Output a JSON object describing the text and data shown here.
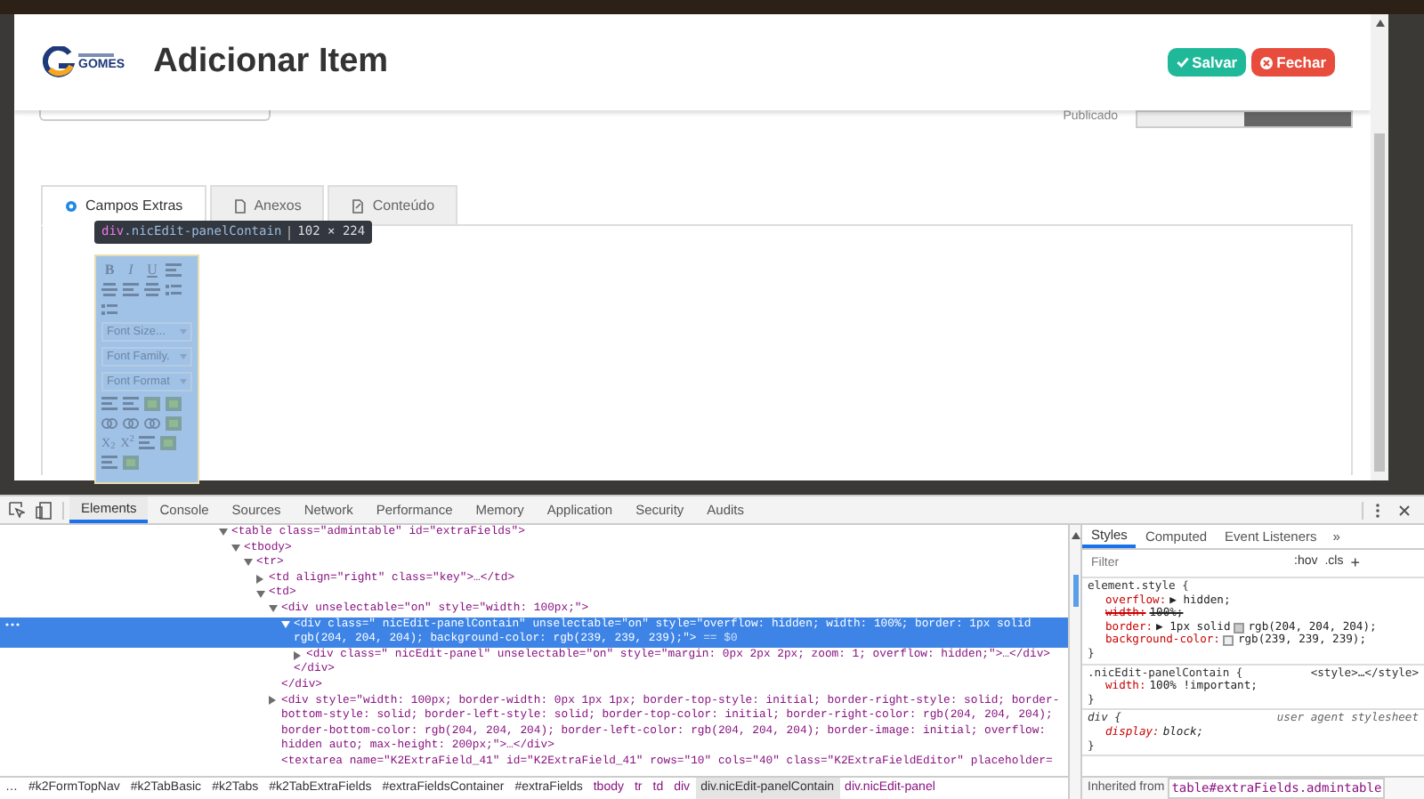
{
  "page": {
    "logo": {
      "text": "GOMES"
    },
    "title": "Adicionar Item",
    "buttons": [
      {
        "label": "Salvar",
        "kind": "save"
      },
      {
        "label": "Fechar",
        "kind": "close"
      }
    ],
    "published_label": "Publicado",
    "tabs": [
      {
        "label": "Campos Extras",
        "selected": true
      },
      {
        "label": "Anexos",
        "selected": false
      },
      {
        "label": "Conteúdo",
        "selected": false
      }
    ]
  },
  "inspector_tooltip": {
    "tag": "div",
    "selector": ".nicEdit-panelContain",
    "size": "102 × 224"
  },
  "editor_toolbar": {
    "format_buttons": [
      "B",
      "I",
      "U"
    ],
    "selects": [
      "Font Size...",
      "Font Family.",
      "Font Format"
    ],
    "script_buttons": [
      "X$_{2}$",
      "X$^{2}$"
    ]
  },
  "devtools": {
    "tabs": [
      {
        "label": "Elements",
        "selected": true
      },
      {
        "label": "Console",
        "selected": false
      },
      {
        "label": "Sources",
        "selected": false
      },
      {
        "label": "Network",
        "selected": false
      },
      {
        "label": "Performance",
        "selected": false
      },
      {
        "label": "Memory",
        "selected": false
      },
      {
        "label": "Application",
        "selected": false
      },
      {
        "label": "Security",
        "selected": false
      },
      {
        "label": "Audits",
        "selected": false
      }
    ],
    "dom_tree": [
      {
        "open": "<table class=\"admintable\" id=\"extraFields\">",
        "expanded": true,
        "selected": false,
        "children": [
          {
            "open": "<tbody>",
            "expanded": true,
            "selected": false,
            "children": [
              {
                "open": "<tr>",
                "expanded": true,
                "selected": false,
                "children": [
                  {
                    "open": "<td align=\"right\" class=\"key\">…</td>",
                    "expanded": false,
                    "selected": false
                  },
                  {
                    "open": "<td>",
                    "expanded": true,
                    "selected": false,
                    "children": [
                      {
                        "open": "<div unselectable=\"on\" style=\"width: 100px;\">",
                        "expanded": true,
                        "selected": false,
                        "closing": "</div>",
                        "children": [
                          {
                            "open": "<div class=\" nicEdit-panelContain\" unselectable=\"on\" style=\"overflow: hidden; width: 100%; border: 1px solid rgb(204, 204, 204); background-color: rgb(239, 239, 239);\">",
                            "suffix": "== $0",
                            "expanded": true,
                            "selected": true,
                            "closing": "</div>",
                            "children": [
                              {
                                "open": "<div class=\" nicEdit-panel\" unselectable=\"on\" style=\"margin: 0px 2px 2px; zoom: 1; overflow: hidden;\">…</div>",
                                "expanded": false,
                                "selected": false
                              }
                            ]
                          }
                        ]
                      },
                      {
                        "open": "<div style=\"width: 100px; border-width: 0px 1px 1px; border-top-style: initial; border-right-style: solid; border-bottom-style: solid; border-left-style: solid; border-top-color: initial; border-right-color: rgb(204, 204, 204); border-bottom-color: rgb(204, 204, 204); border-left-color: rgb(204, 204, 204); border-image: initial; overflow: hidden auto; max-height: 200px;\">…</div>",
                        "expanded": false,
                        "selected": false
                      },
                      {
                        "open": "<textarea name=\"K2ExtraField_41\" id=\"K2ExtraField_41\" rows=\"10\" cols=\"40\" class=\"K2ExtraFieldEditor\" placeholder=",
                        "selected": false
                      }
                    ]
                  }
                ]
              }
            ]
          }
        ]
      }
    ],
    "breadcrumbs": [
      {
        "label": "…",
        "kind": "id",
        "selected": false
      },
      {
        "label": "#k2FormTopNav",
        "kind": "id",
        "selected": false
      },
      {
        "label": "#k2TabBasic",
        "kind": "id",
        "selected": false
      },
      {
        "label": "#k2Tabs",
        "kind": "id",
        "selected": false
      },
      {
        "label": "#k2TabExtraFields",
        "kind": "id",
        "selected": false
      },
      {
        "label": "#extraFieldsContainer",
        "kind": "id",
        "selected": false
      },
      {
        "label": "#extraFields",
        "kind": "id",
        "selected": false
      },
      {
        "label": "tbody",
        "kind": "tag",
        "selected": false
      },
      {
        "label": "tr",
        "kind": "tag",
        "selected": false
      },
      {
        "label": "td",
        "kind": "tag",
        "selected": false
      },
      {
        "label": "div",
        "kind": "tag",
        "selected": false
      },
      {
        "label": "div.nicEdit-panelContain",
        "kind": "id",
        "selected": true
      },
      {
        "label": "div.nicEdit-panel",
        "kind": "tag",
        "selected": false
      }
    ],
    "styles": {
      "tabs": [
        {
          "label": "Styles",
          "selected": true
        },
        {
          "label": "Computed",
          "selected": false
        },
        {
          "label": "Event Listeners",
          "selected": false
        }
      ],
      "more": "»",
      "filter": {
        "placeholder": "Filter"
      },
      "hov": ":hov",
      "cls": ".cls",
      "add": "+",
      "rules": [
        {
          "selector": "element.style {",
          "kind": "inline",
          "close": "}",
          "properties": [
            {
              "name": "overflow:",
              "value": "▶ hidden;",
              "struck": false
            },
            {
              "name": "width:",
              "value": "100%;",
              "struck": true
            },
            {
              "name": "border:",
              "value_before": "▶ 1px solid",
              "color": "#cccccc",
              "value": "rgb(204, 204, 204);",
              "struck": false
            },
            {
              "name": "background-color:",
              "color": "#efefef",
              "value": "rgb(239, 239, 239);",
              "struck": false
            }
          ]
        },
        {
          "selector": ".nicEdit-panelContain {",
          "source": "<style>…</style>",
          "kind": "author",
          "close": "}",
          "properties": [
            {
              "name": "width:",
              "value": "100% !important;",
              "struck": false
            }
          ]
        },
        {
          "selector": "div {",
          "source": "user agent stylesheet",
          "kind": "user-agent",
          "close": "}",
          "properties": [
            {
              "name": "display:",
              "value": "block;",
              "struck": false
            }
          ]
        }
      ],
      "inherited": {
        "label": "Inherited from",
        "selector": "table#extraFields.admintable"
      }
    }
  }
}
